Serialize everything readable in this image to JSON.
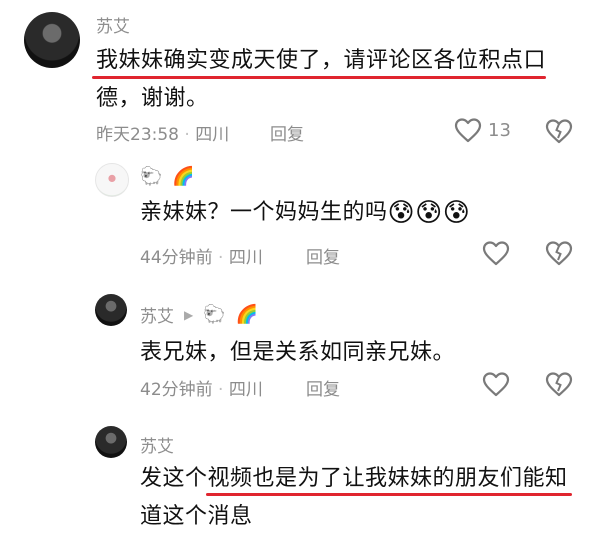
{
  "comments": [
    {
      "username": "苏艾",
      "text_line1": "我妹妹确实变成天使了，请评论区各位积点口",
      "text_line2": "德，谢谢。",
      "time": "昨天23:58",
      "location": "四川",
      "reply_label": "回复",
      "like_count": "13"
    },
    {
      "username": "",
      "badges": [
        "🐑",
        "🌈"
      ],
      "text": "亲妹妹？一个妈妈生的吗",
      "emojis": [
        "😰",
        "😰",
        "😰"
      ],
      "time": "44分钟前",
      "location": "四川",
      "reply_label": "回复"
    },
    {
      "username": "苏艾",
      "reply_arrow": "▶",
      "badges": [
        "🐑",
        "🌈"
      ],
      "text": "表兄妹，但是关系如同亲兄妹。",
      "time": "42分钟前",
      "location": "四川",
      "reply_label": "回复"
    },
    {
      "username": "苏艾",
      "text_line1": "发这个视频也是为了让我妹妹的朋友们能知",
      "text_line2": "道这个消息"
    }
  ],
  "separator": "·",
  "colors": {
    "underline": "#e0252f",
    "meta": "#8c8c8c"
  },
  "icons": [
    "heart-icon",
    "broken-heart-icon"
  ]
}
